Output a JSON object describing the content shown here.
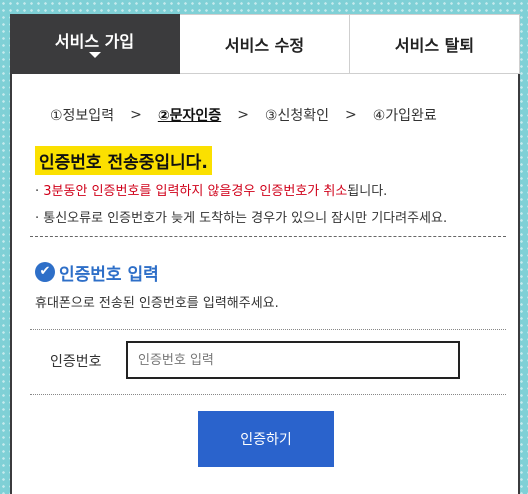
{
  "tabs": [
    {
      "label": "서비스 가입",
      "active": true
    },
    {
      "label": "서비스 수정",
      "active": false
    },
    {
      "label": "서비스 탈퇴",
      "active": false
    }
  ],
  "steps": [
    {
      "label": "①정보입력"
    },
    {
      "label": "②문자인증",
      "current": true
    },
    {
      "label": "③신청확인"
    },
    {
      "label": "④가입완료"
    }
  ],
  "step_separator": ">",
  "notice": {
    "title": "인증번호 전송중입니다.",
    "line1_prefix": "·",
    "line1_red_a": "3분동안 인증번호를 입력하지 않을경우 인증번호가 취소",
    "line1_suffix": "됩니다.",
    "line2": "· 통신오류로 인증번호가 늦게 도착하는 경우가 있으니 잠시만 기다려주세요."
  },
  "section": {
    "icon": "check-circle-icon",
    "title": "인증번호 입력",
    "desc": "휴대폰으로 전송된 인증번호를 입력해주세요."
  },
  "form": {
    "label": "인증번호",
    "placeholder": "인증번호 입력",
    "value": ""
  },
  "submit_label": "인증하기",
  "colors": {
    "accent": "#2a63cc",
    "highlight": "#fbe000",
    "warning": "#d0021b",
    "tab_active": "#3b3b3d"
  }
}
